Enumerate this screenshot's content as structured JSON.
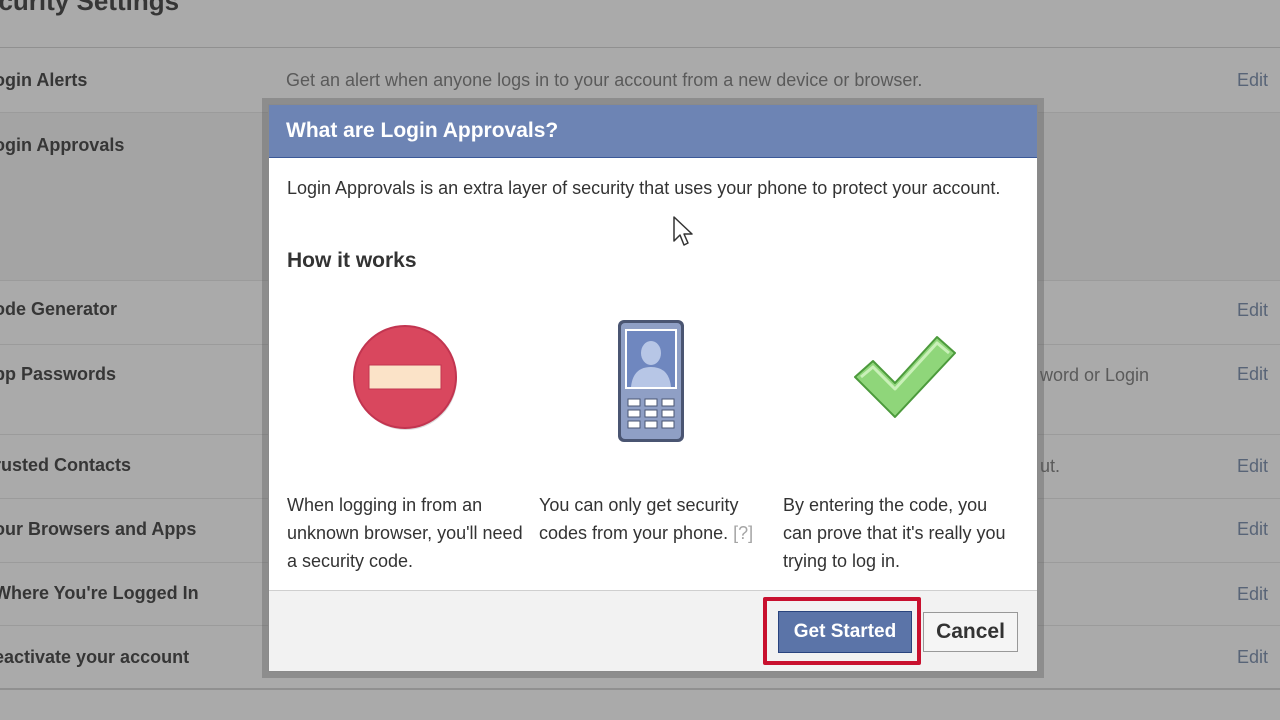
{
  "page": {
    "title": "ecurity Settings",
    "settings": [
      {
        "label": "ogin Alerts",
        "description": "Get an alert when anyone logs in to your account from a new device or browser.",
        "edit": "Edit"
      },
      {
        "label": "ogin Approvals",
        "description": "",
        "edit": ""
      },
      {
        "label": "ode Generator",
        "description": "",
        "edit": "Edit"
      },
      {
        "label": "pp Passwords",
        "description": "word or Login",
        "edit": "Edit"
      },
      {
        "label": "rusted Contacts",
        "description": "ut.",
        "edit": "Edit"
      },
      {
        "label": "our Browsers and Apps",
        "description": "",
        "edit": "Edit"
      },
      {
        "label": "Where You're Logged In",
        "description": "",
        "edit": "Edit"
      },
      {
        "label": "eactivate your account",
        "description": "",
        "edit": "Edit"
      }
    ]
  },
  "dialog": {
    "title": "What are Login Approvals?",
    "intro": "Login Approvals is an extra layer of security that uses your phone to protect your account.",
    "how_it_works": "How it works",
    "steps": [
      {
        "icon": "no-entry-icon",
        "text": "When logging in from an unknown browser, you'll need a security code."
      },
      {
        "icon": "phone-icon",
        "text": "You can only get security codes from your phone.",
        "help": "[?]"
      },
      {
        "icon": "checkmark-icon",
        "text": "By entering the code, you can prove that it's really you trying to log in."
      }
    ],
    "get_started": "Get Started",
    "cancel": "Cancel"
  },
  "colors": {
    "header_blue": "#6d84b4",
    "button_blue": "#5b74a8",
    "highlight_red": "#c8102e",
    "stop_red": "#d9475e",
    "check_green": "#8fd67a"
  }
}
